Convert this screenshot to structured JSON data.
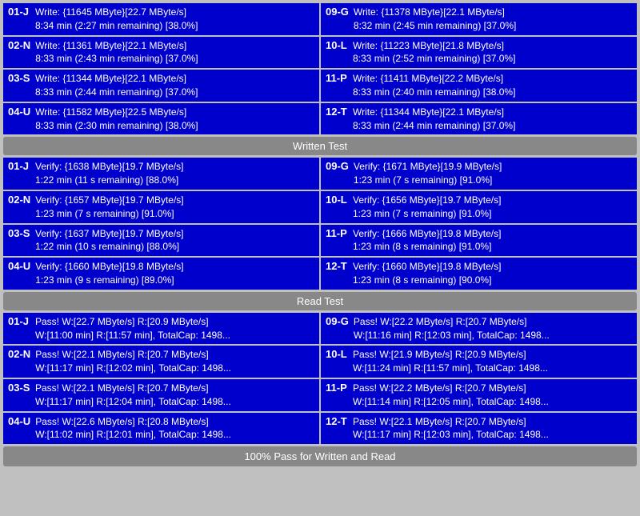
{
  "sections": {
    "write_test": {
      "header": "Written Test",
      "left_cells": [
        {
          "id": "01-J",
          "line1": "Write: {11645 MByte}[22.7 MByte/s]",
          "line2": "8:34 min (2:27 min remaining)  [38.0%]"
        },
        {
          "id": "02-N",
          "line1": "Write: {11361 MByte}[22.1 MByte/s]",
          "line2": "8:33 min (2:43 min remaining)  [37.0%]"
        },
        {
          "id": "03-S",
          "line1": "Write: {11344 MByte}[22.1 MByte/s]",
          "line2": "8:33 min (2:44 min remaining)  [37.0%]"
        },
        {
          "id": "04-U",
          "line1": "Write: {11582 MByte}[22.5 MByte/s]",
          "line2": "8:33 min (2:30 min remaining)  [38.0%]"
        }
      ],
      "right_cells": [
        {
          "id": "09-G",
          "line1": "Write: {11378 MByte}[22.1 MByte/s]",
          "line2": "8:32 min (2:45 min remaining)  [37.0%]"
        },
        {
          "id": "10-L",
          "line1": "Write: {11223 MByte}[21.8 MByte/s]",
          "line2": "8:33 min (2:52 min remaining)  [37.0%]"
        },
        {
          "id": "11-P",
          "line1": "Write: {11411 MByte}[22.2 MByte/s]",
          "line2": "8:33 min (2:40 min remaining)  [38.0%]"
        },
        {
          "id": "12-T",
          "line1": "Write: {11344 MByte}[22.1 MByte/s]",
          "line2": "8:33 min (2:44 min remaining)  [37.0%]"
        }
      ]
    },
    "verify_test": {
      "left_cells": [
        {
          "id": "01-J",
          "line1": "Verify: {1638 MByte}[19.7 MByte/s]",
          "line2": "1:22 min (11 s remaining)  [88.0%]"
        },
        {
          "id": "02-N",
          "line1": "Verify: {1657 MByte}[19.7 MByte/s]",
          "line2": "1:23 min (7 s remaining)  [91.0%]"
        },
        {
          "id": "03-S",
          "line1": "Verify: {1637 MByte}[19.7 MByte/s]",
          "line2": "1:22 min (10 s remaining)  [88.0%]"
        },
        {
          "id": "04-U",
          "line1": "Verify: {1660 MByte}[19.8 MByte/s]",
          "line2": "1:23 min (9 s remaining)  [89.0%]"
        }
      ],
      "right_cells": [
        {
          "id": "09-G",
          "line1": "Verify: {1671 MByte}[19.9 MByte/s]",
          "line2": "1:23 min (7 s remaining)  [91.0%]"
        },
        {
          "id": "10-L",
          "line1": "Verify: {1656 MByte}[19.7 MByte/s]",
          "line2": "1:23 min (7 s remaining)  [91.0%]"
        },
        {
          "id": "11-P",
          "line1": "Verify: {1666 MByte}[19.8 MByte/s]",
          "line2": "1:23 min (8 s remaining)  [91.0%]"
        },
        {
          "id": "12-T",
          "line1": "Verify: {1660 MByte}[19.8 MByte/s]",
          "line2": "1:23 min (8 s remaining)  [90.0%]"
        }
      ]
    },
    "read_test": {
      "header": "Read Test",
      "left_cells": [
        {
          "id": "01-J",
          "line1": "Pass! W:[22.7 MByte/s] R:[20.9 MByte/s]",
          "line2": "W:[11:00 min] R:[11:57 min], TotalCap: 1498..."
        },
        {
          "id": "02-N",
          "line1": "Pass! W:[22.1 MByte/s] R:[20.7 MByte/s]",
          "line2": "W:[11:17 min] R:[12:02 min], TotalCap: 1498..."
        },
        {
          "id": "03-S",
          "line1": "Pass! W:[22.1 MByte/s] R:[20.7 MByte/s]",
          "line2": "W:[11:17 min] R:[12:04 min], TotalCap: 1498..."
        },
        {
          "id": "04-U",
          "line1": "Pass! W:[22.6 MByte/s] R:[20.8 MByte/s]",
          "line2": "W:[11:02 min] R:[12:01 min], TotalCap: 1498..."
        }
      ],
      "right_cells": [
        {
          "id": "09-G",
          "line1": "Pass! W:[22.2 MByte/s] R:[20.7 MByte/s]",
          "line2": "W:[11:16 min] R:[12:03 min], TotalCap: 1498..."
        },
        {
          "id": "10-L",
          "line1": "Pass! W:[21.9 MByte/s] R:[20.9 MByte/s]",
          "line2": "W:[11:24 min] R:[11:57 min], TotalCap: 1498..."
        },
        {
          "id": "11-P",
          "line1": "Pass! W:[22.2 MByte/s] R:[20.7 MByte/s]",
          "line2": "W:[11:14 min] R:[12:05 min], TotalCap: 1498..."
        },
        {
          "id": "12-T",
          "line1": "Pass! W:[22.1 MByte/s] R:[20.7 MByte/s]",
          "line2": "W:[11:17 min] R:[12:03 min], TotalCap: 1498..."
        }
      ]
    }
  },
  "headers": {
    "written_test": "Written Test",
    "read_test": "Read Test",
    "bottom": "100% Pass for Written and Read"
  }
}
